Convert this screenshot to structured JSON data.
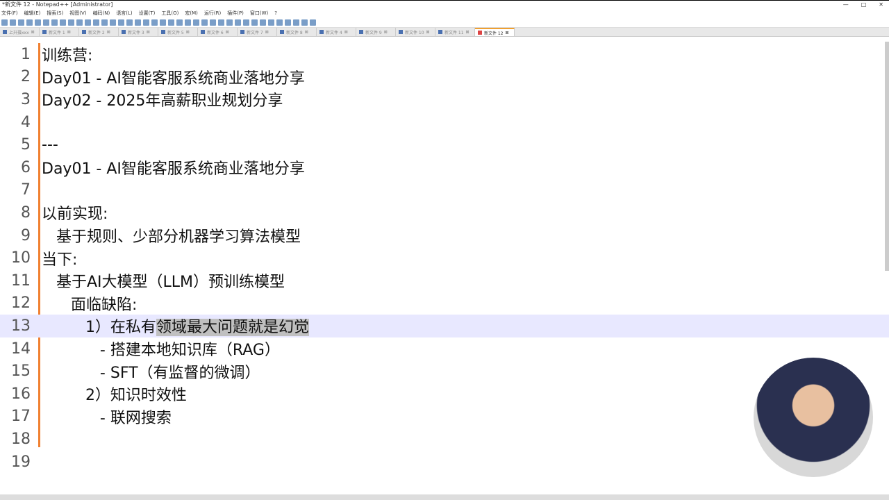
{
  "window": {
    "title": "*新文件 12 - Notepad++ [Administrator]",
    "controls": [
      "—",
      "□",
      "✕"
    ]
  },
  "menu": [
    "文件(F)",
    "编辑(E)",
    "搜索(S)",
    "视图(V)",
    "编码(N)",
    "语言(L)",
    "设置(T)",
    "工具(O)",
    "宏(M)",
    "运行(R)",
    "插件(P)",
    "窗口(W)",
    "?"
  ],
  "tabs": [
    "上升摄xxx",
    "新文件 1",
    "新文件 2",
    "新文件 3",
    "新文件 5",
    "新文件 6",
    "新文件 7",
    "新文件 8",
    "新文件 4",
    "新文件 9",
    "新文件 10",
    "新文件 11",
    "新文件 12"
  ],
  "active_tab": 12,
  "lines": [
    {
      "n": "1",
      "t": "训练营:"
    },
    {
      "n": "2",
      "t": "Day01 - AI智能客服系统商业落地分享"
    },
    {
      "n": "3",
      "t": "Day02 - 2025年高薪职业规划分享"
    },
    {
      "n": "4",
      "t": ""
    },
    {
      "n": "5",
      "t": "---"
    },
    {
      "n": "6",
      "t": "Day01 - AI智能客服系统商业落地分享"
    },
    {
      "n": "7",
      "t": ""
    },
    {
      "n": "8",
      "t": "以前实现:"
    },
    {
      "n": "9",
      "t": "   基于规则、少部分机器学习算法模型"
    },
    {
      "n": "10",
      "t": "当下:"
    },
    {
      "n": "11",
      "t": "   基于AI大模型（LLM）预训练模型"
    },
    {
      "n": "12",
      "t": "      面临缺陷:"
    },
    {
      "n": "13",
      "t": "         1）在私有",
      "sel": "领域最大问题就是幻觉"
    },
    {
      "n": "14",
      "t": "            - 搭建本地知识库（RAG）"
    },
    {
      "n": "15",
      "t": "            - SFT（有监督的微调）"
    },
    {
      "n": "16",
      "t": "         2）知识时效性"
    },
    {
      "n": "17",
      "t": "            - 联网搜索"
    },
    {
      "n": "18",
      "t": ""
    },
    {
      "n": "19",
      "t": ""
    }
  ],
  "current_line": 13
}
